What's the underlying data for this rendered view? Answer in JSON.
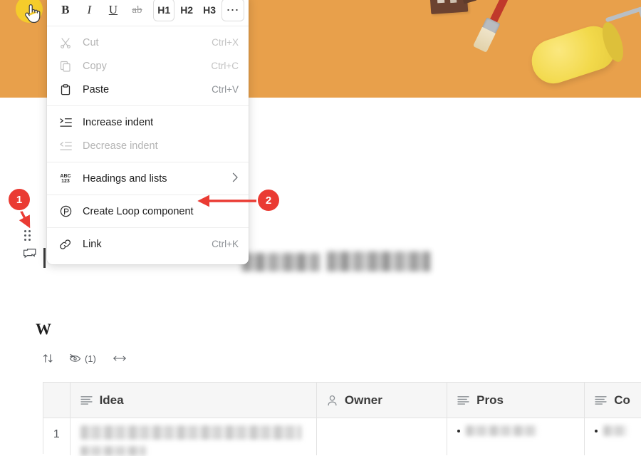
{
  "app": {
    "banner": {
      "name": "orange-paint-banner",
      "bg_color": "#e8a04b",
      "accent_dot_color": "#f5cc2b",
      "objects": [
        "house-illustration",
        "paint-brush",
        "paint-roller"
      ]
    },
    "cursor": "hand-pointer-cursor"
  },
  "context_menu": {
    "format_toolbar": [
      {
        "id": "bold",
        "label": "B",
        "icon": "bold-icon",
        "state": "normal"
      },
      {
        "id": "italic",
        "label": "I",
        "icon": "italic-icon",
        "state": "normal"
      },
      {
        "id": "underline",
        "label": "U",
        "icon": "underline-icon",
        "state": "normal"
      },
      {
        "id": "strikethrough",
        "label": "ab",
        "icon": "strikethrough-icon",
        "state": "dim"
      },
      {
        "id": "h1",
        "label": "H1",
        "icon": "heading-1-icon",
        "state": "boxed"
      },
      {
        "id": "h2",
        "label": "H2",
        "icon": "heading-2-icon",
        "state": "normal"
      },
      {
        "id": "h3",
        "label": "H3",
        "icon": "heading-3-icon",
        "state": "normal"
      },
      {
        "id": "more",
        "label": "⋯",
        "icon": "more-options-icon",
        "state": "boxed"
      }
    ],
    "groups": [
      {
        "name": "clipboard",
        "items": [
          {
            "id": "cut",
            "label": "Cut",
            "shortcut": "Ctrl+X",
            "icon": "scissors-icon",
            "disabled": true
          },
          {
            "id": "copy",
            "label": "Copy",
            "shortcut": "Ctrl+C",
            "icon": "copy-icon",
            "disabled": true
          },
          {
            "id": "paste",
            "label": "Paste",
            "shortcut": "Ctrl+V",
            "icon": "clipboard-icon",
            "disabled": false
          }
        ]
      },
      {
        "name": "indent",
        "items": [
          {
            "id": "increase-indent",
            "label": "Increase indent",
            "shortcut": "",
            "icon": "increase-indent-icon",
            "disabled": false
          },
          {
            "id": "decrease-indent",
            "label": "Decrease indent",
            "shortcut": "",
            "icon": "decrease-indent-icon",
            "disabled": true
          }
        ]
      },
      {
        "name": "headings",
        "items": [
          {
            "id": "headings-and-lists",
            "label": "Headings and lists",
            "shortcut": "",
            "icon": "abc123-icon",
            "disabled": false,
            "submenu": true
          }
        ]
      },
      {
        "name": "loop",
        "items": [
          {
            "id": "create-loop-component",
            "label": "Create Loop component",
            "shortcut": "",
            "icon": "loop-icon",
            "disabled": false
          }
        ]
      },
      {
        "name": "link",
        "items": [
          {
            "id": "link",
            "label": "Link",
            "shortcut": "Ctrl+K",
            "icon": "link-icon",
            "disabled": false
          }
        ]
      }
    ]
  },
  "gutter": {
    "drag_handle": "drag-handle-dots",
    "comment": "comment-bubble-icon"
  },
  "table_toolbar": {
    "sort_label": "",
    "hidden_label": "(1)",
    "resize_label": ""
  },
  "table": {
    "columns": [
      {
        "id": "rownum",
        "label": "",
        "icon": ""
      },
      {
        "id": "idea",
        "label": "Idea",
        "icon": "text-lines-icon"
      },
      {
        "id": "owner",
        "label": "Owner",
        "icon": "person-icon"
      },
      {
        "id": "pros",
        "label": "Pros",
        "icon": "text-lines-icon"
      },
      {
        "id": "cons",
        "label": "Co",
        "icon": "text-lines-icon"
      }
    ],
    "rows": [
      {
        "number": "1",
        "idea": "",
        "owner": "",
        "pros": "",
        "cons": ""
      }
    ]
  },
  "annotations": {
    "badge_color": "#ea3b33",
    "markers": [
      {
        "id": "1",
        "label": "1",
        "points_to": "drag-handle-dots"
      },
      {
        "id": "2",
        "label": "2",
        "points_to": "create-loop-component"
      }
    ]
  }
}
